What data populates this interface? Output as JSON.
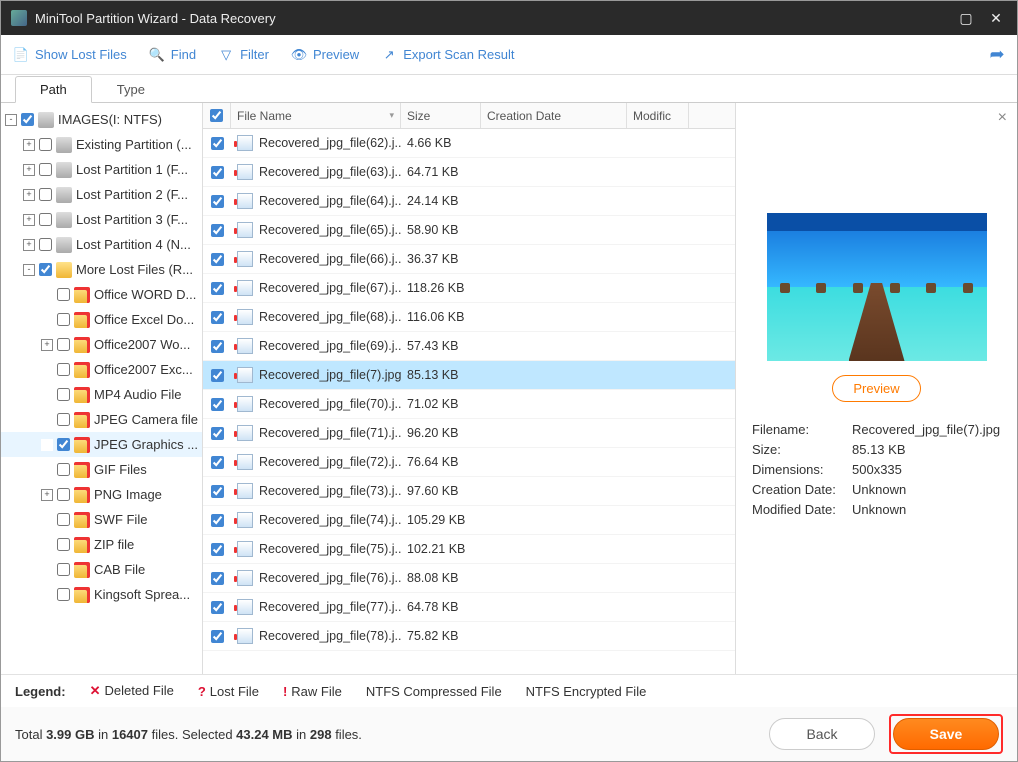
{
  "title": "MiniTool Partition Wizard - Data Recovery",
  "toolbar": {
    "show_lost": "Show Lost Files",
    "find": "Find",
    "filter": "Filter",
    "preview": "Preview",
    "export": "Export Scan Result"
  },
  "tabs": {
    "path": "Path",
    "type": "Type"
  },
  "tree": [
    {
      "depth": 0,
      "expander": "-",
      "checked": true,
      "icon": "drive",
      "label": "IMAGES(I: NTFS)"
    },
    {
      "depth": 1,
      "expander": "+",
      "checked": false,
      "icon": "drive",
      "label": "Existing Partition (..."
    },
    {
      "depth": 1,
      "expander": "+",
      "checked": false,
      "icon": "drive",
      "label": "Lost Partition 1 (F..."
    },
    {
      "depth": 1,
      "expander": "+",
      "checked": false,
      "icon": "drive",
      "label": "Lost Partition 2 (F..."
    },
    {
      "depth": 1,
      "expander": "+",
      "checked": false,
      "icon": "drive",
      "label": "Lost Partition 3 (F..."
    },
    {
      "depth": 1,
      "expander": "+",
      "checked": false,
      "icon": "drive",
      "label": "Lost Partition 4 (N..."
    },
    {
      "depth": 1,
      "expander": "-",
      "checked": true,
      "icon": "folder",
      "label": "More Lost Files (R..."
    },
    {
      "depth": 2,
      "expander": "",
      "checked": false,
      "icon": "folder-red",
      "label": "Office WORD D..."
    },
    {
      "depth": 2,
      "expander": "",
      "checked": false,
      "icon": "folder-red",
      "label": "Office Excel Do..."
    },
    {
      "depth": 2,
      "expander": "+",
      "checked": false,
      "icon": "folder-red",
      "label": "Office2007 Wo..."
    },
    {
      "depth": 2,
      "expander": "",
      "checked": false,
      "icon": "folder-red",
      "label": "Office2007 Exc..."
    },
    {
      "depth": 2,
      "expander": "",
      "checked": false,
      "icon": "folder-red",
      "label": "MP4 Audio File"
    },
    {
      "depth": 2,
      "expander": "",
      "checked": false,
      "icon": "folder-red",
      "label": "JPEG Camera file"
    },
    {
      "depth": 2,
      "expander": "",
      "checked": true,
      "icon": "folder-red",
      "label": "JPEG Graphics ...",
      "selected": true
    },
    {
      "depth": 2,
      "expander": "",
      "checked": false,
      "icon": "folder-red",
      "label": "GIF Files"
    },
    {
      "depth": 2,
      "expander": "+",
      "checked": false,
      "icon": "folder-red",
      "label": "PNG Image"
    },
    {
      "depth": 2,
      "expander": "",
      "checked": false,
      "icon": "folder-red",
      "label": "SWF File"
    },
    {
      "depth": 2,
      "expander": "",
      "checked": false,
      "icon": "folder-red",
      "label": "ZIP file"
    },
    {
      "depth": 2,
      "expander": "",
      "checked": false,
      "icon": "folder-red",
      "label": "CAB File"
    },
    {
      "depth": 2,
      "expander": "",
      "checked": false,
      "icon": "folder-red",
      "label": "Kingsoft Sprea..."
    }
  ],
  "columns": {
    "name": "File Name",
    "size": "Size",
    "date": "Creation Date",
    "mod": "Modific"
  },
  "files": [
    {
      "name": "Recovered_jpg_file(62).j...",
      "size": "4.66 KB"
    },
    {
      "name": "Recovered_jpg_file(63).j...",
      "size": "64.71 KB"
    },
    {
      "name": "Recovered_jpg_file(64).j...",
      "size": "24.14 KB"
    },
    {
      "name": "Recovered_jpg_file(65).j...",
      "size": "58.90 KB"
    },
    {
      "name": "Recovered_jpg_file(66).j...",
      "size": "36.37 KB"
    },
    {
      "name": "Recovered_jpg_file(67).j...",
      "size": "118.26 KB"
    },
    {
      "name": "Recovered_jpg_file(68).j...",
      "size": "116.06 KB"
    },
    {
      "name": "Recovered_jpg_file(69).j...",
      "size": "57.43 KB"
    },
    {
      "name": "Recovered_jpg_file(7).jpg",
      "size": "85.13 KB",
      "selected": true
    },
    {
      "name": "Recovered_jpg_file(70).j...",
      "size": "71.02 KB"
    },
    {
      "name": "Recovered_jpg_file(71).j...",
      "size": "96.20 KB"
    },
    {
      "name": "Recovered_jpg_file(72).j...",
      "size": "76.64 KB"
    },
    {
      "name": "Recovered_jpg_file(73).j...",
      "size": "97.60 KB"
    },
    {
      "name": "Recovered_jpg_file(74).j...",
      "size": "105.29 KB"
    },
    {
      "name": "Recovered_jpg_file(75).j...",
      "size": "102.21 KB"
    },
    {
      "name": "Recovered_jpg_file(76).j...",
      "size": "88.08 KB"
    },
    {
      "name": "Recovered_jpg_file(77).j...",
      "size": "64.78 KB"
    },
    {
      "name": "Recovered_jpg_file(78).j...",
      "size": "75.82 KB"
    }
  ],
  "preview": {
    "button": "Preview",
    "filename_label": "Filename:",
    "filename": "Recovered_jpg_file(7).jpg",
    "size_label": "Size:",
    "size": "85.13 KB",
    "dim_label": "Dimensions:",
    "dim": "500x335",
    "cdate_label": "Creation Date:",
    "cdate": "Unknown",
    "mdate_label": "Modified Date:",
    "mdate": "Unknown"
  },
  "legend": {
    "title": "Legend:",
    "deleted": "Deleted File",
    "lost": "Lost File",
    "raw": "Raw File",
    "ntfs_c": "NTFS Compressed File",
    "ntfs_e": "NTFS Encrypted File"
  },
  "footer": {
    "totals_prefix": "Total ",
    "total_size": "3.99 GB",
    "totals_mid": " in ",
    "total_files": "16407",
    "totals_suffix": " files.  Selected ",
    "sel_size": "43.24 MB",
    "sel_mid": " in ",
    "sel_files": "298",
    "sel_suffix": " files.",
    "back": "Back",
    "save": "Save"
  }
}
